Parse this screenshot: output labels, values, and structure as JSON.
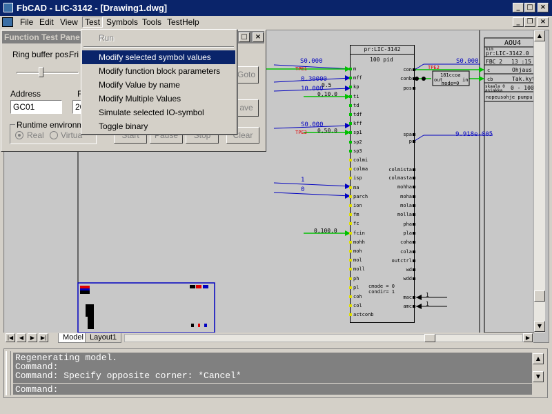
{
  "window": {
    "title": "FbCAD - LIC-3142 - [Drawing1.dwg]",
    "min_glyph": "_",
    "max_glyph": "□",
    "close_glyph": "×",
    "restore_glyph": "❐"
  },
  "menubar": {
    "items": [
      "File",
      "Edit",
      "View",
      "Test",
      "Symbols",
      "Tools",
      "TestHelp"
    ]
  },
  "test_menu": {
    "items": [
      {
        "label": "Run",
        "disabled": true
      },
      {
        "label": "Modify selected symbol values",
        "highlighted": true
      },
      {
        "label": "Modify function block parameters"
      },
      {
        "label": "Modify Value by name"
      },
      {
        "label": "Modify Multiple Values"
      },
      {
        "label": "Simulate selected IO-symbol"
      },
      {
        "label": "Toggle binary"
      }
    ]
  },
  "function_test_panel": {
    "title": "Function Test Pane",
    "ring_buffer_label": "Ring buffer pos.",
    "ring_buffer_value": "Fri N",
    "address_label": "Address",
    "address_value": "GC01",
    "f_label": "F",
    "f_value": "20",
    "runtime_label": "Runtime environme",
    "radio_real": "Real",
    "radio_virtual": "Virtua",
    "goto_button": "Goto",
    "save_button": "ave",
    "start_button": "Start",
    "pause_button": "Pause",
    "stop_button": "Stop",
    "clear_button": "Clear"
  },
  "tabs": {
    "model": "Model",
    "layout1": "Layout1"
  },
  "command": {
    "history": [
      "Regenerating model.",
      "Command:",
      "Command: Specify opposite corner: *Cancel*"
    ],
    "prompt": "Command:"
  },
  "function_block": {
    "header_tag": "pr:LIC-3142",
    "header_type": "100 pid",
    "left_pins": [
      "m",
      "mff",
      "kp",
      "ti",
      "td",
      "tdf",
      "kff",
      "sp1",
      "sp2",
      "sp3",
      "colmi",
      "colma",
      "isp",
      "ma",
      "parch",
      "ion",
      "fm",
      "fc",
      "fcin",
      "mohh",
      "moh",
      "mol",
      "moll",
      "ph",
      "pl",
      "coh",
      "col",
      "actconb"
    ],
    "right_pins": [
      "con",
      "conb",
      "pos",
      "spa",
      "p",
      "colmista",
      "colmasta",
      "mohha",
      "moha",
      "mola",
      "molla",
      "pha",
      "pla",
      "coha",
      "cola",
      "outctrl",
      "wd",
      "wdd",
      "mac",
      "amc"
    ],
    "mode_text": "cmode = 0",
    "condir_text": "condir= 1"
  },
  "signals": {
    "in_m": "S0.000",
    "in_mff": "0.30000",
    "in_kp": "10.000",
    "in_ti": "0,10.0",
    "in_kff_1": "S0.000",
    "in_kff_2": "0,50.0",
    "in_isp": "1",
    "in_ma": "0",
    "in_fcin": "0,100.0",
    "val_mff_small": "0.5",
    "out_con": "S0.000",
    "out_p": "9.918e-005",
    "tag_tpe1": "TPE1",
    "tag_tpe3": "TPE3",
    "tag_tpe2": "TPE2",
    "mac_val": "1",
    "amc_val": "1"
  },
  "aux_block": {
    "title": "181ccoa",
    "left": "out",
    "right": "in",
    "mode": "mode=0"
  },
  "title_block": {
    "header": "AOU4",
    "lbl_kim": "kim",
    "tag": "pr:LIC-3142.0",
    "fbc": "FBC 2",
    "time": "13 :15",
    "pin_c": "c",
    "pin_cb": "cb",
    "ohjaus": "Ohjaus",
    "tak": "Tak.kyth",
    "scale_label": "skaala 0",
    "scale_label2": "asiakka",
    "scale_range": "0 - 100",
    "note": "nopeusohje pumpu"
  },
  "colors": {
    "title_bar": "#0a246a",
    "menu_highlight": "#0a246a",
    "signal_blue": "#0000c0",
    "pin_green": "#00c000",
    "tag_red": "#e00000",
    "drawing_bg": "#c8c8c8",
    "command_bg": "#808080"
  }
}
